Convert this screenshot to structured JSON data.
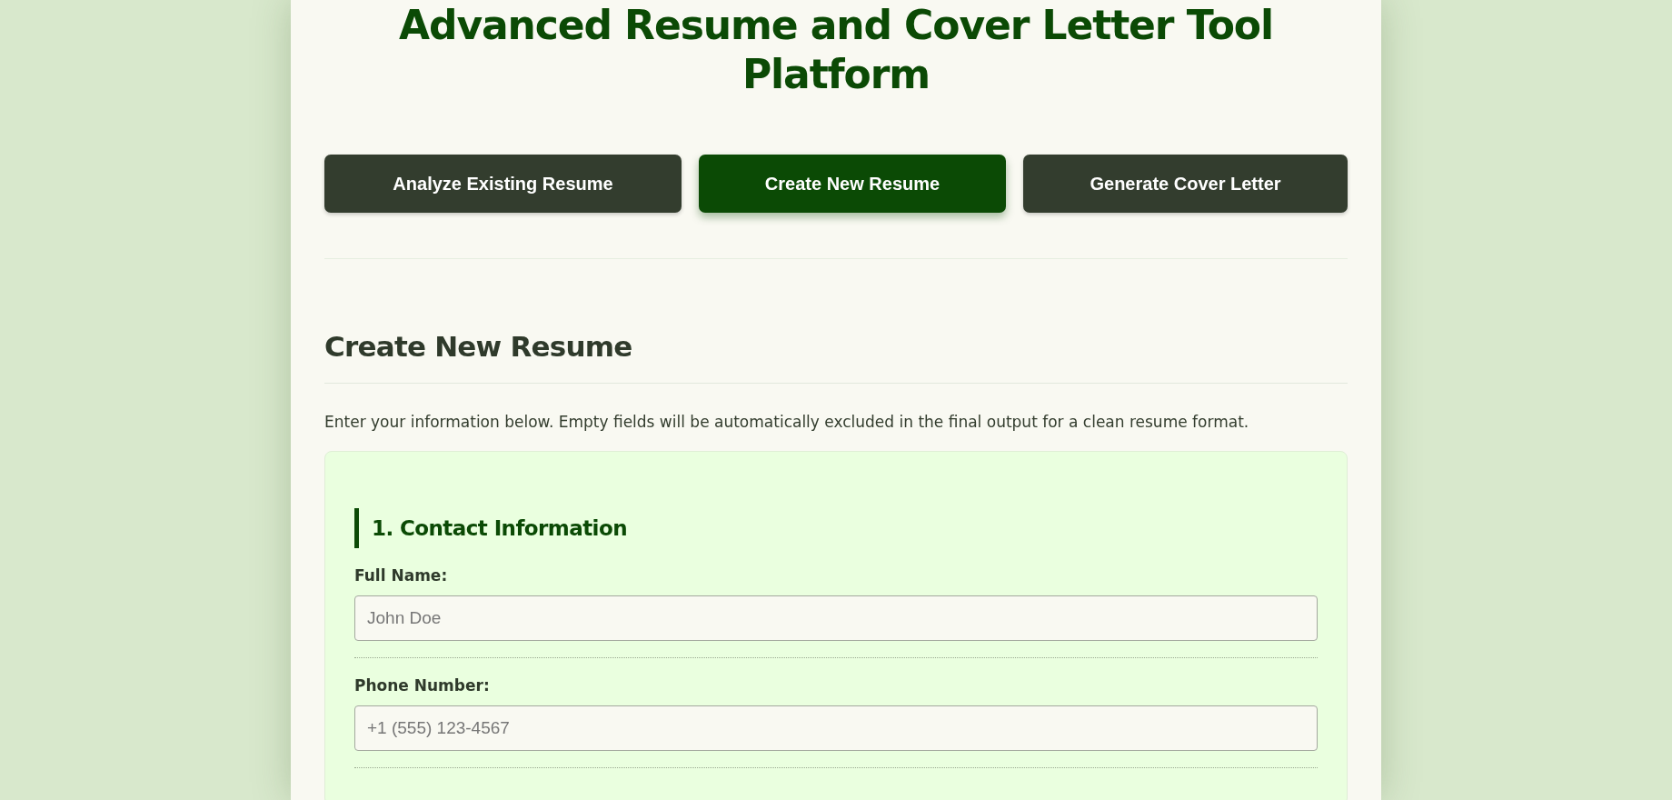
{
  "title": "Advanced Resume and Cover Letter Tool Platform",
  "tabs": [
    {
      "label": "Analyze Existing Resume",
      "selected": false
    },
    {
      "label": "Create New Resume",
      "selected": true
    },
    {
      "label": "Generate Cover Letter",
      "selected": false
    }
  ],
  "section": {
    "heading": "Create New Resume",
    "intro": "Enter your information below. Empty fields will be automatically excluded in the final output for a clean resume format.",
    "group": {
      "title": "1. Contact Information",
      "fields": [
        {
          "label": "Full Name:",
          "placeholder": "John Doe"
        },
        {
          "label": "Phone Number:",
          "placeholder": "+1 (555) 123-4567"
        }
      ]
    }
  }
}
